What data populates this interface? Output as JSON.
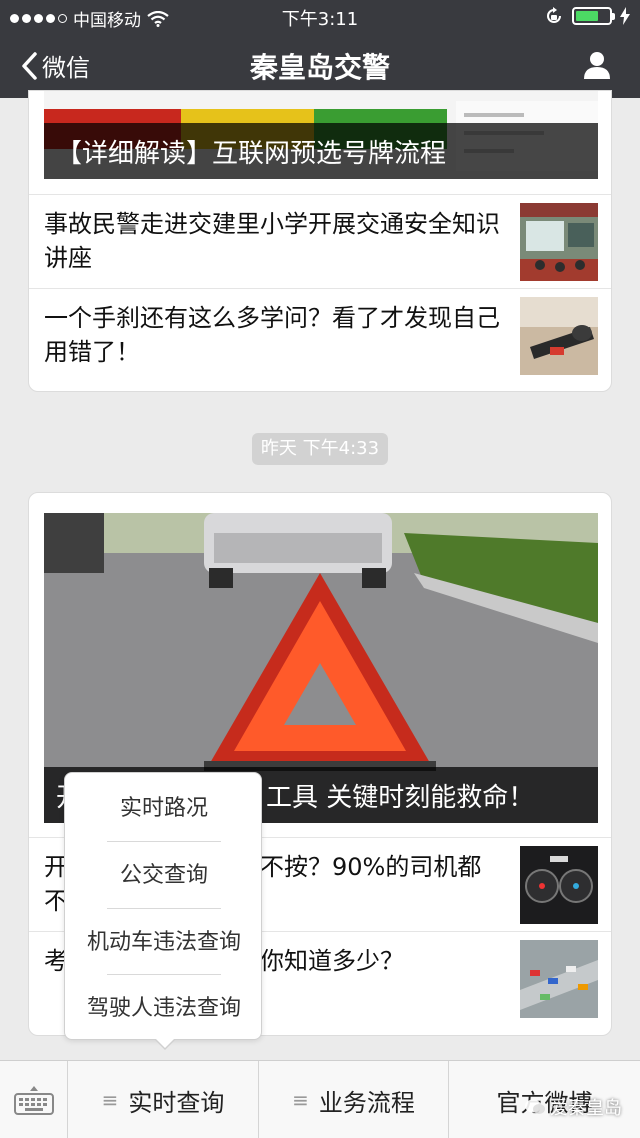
{
  "status_bar": {
    "carrier": "中国移动",
    "time": "下午3:11"
  },
  "nav": {
    "back_label": "微信",
    "title": "秦皇岛交警"
  },
  "card1": {
    "hero_caption": "【详细解读】互联网预选号牌流程",
    "articles": [
      {
        "title": "事故民警走进交建里小学开展交通安全知识讲座"
      },
      {
        "title": "一个手刹还有这么多学问？看了才发现自己用错了！"
      }
    ]
  },
  "timestamp": "昨天 下午4:33",
  "card2": {
    "hero_caption": "开车必备的这个工具 关键时刻能救命！",
    "hero_caption_visible_right": "工具 关键时刻能救命！",
    "hero_caption_visible_left": "开",
    "articles": [
      {
        "visible_left": "开",
        "visible_left2": "不",
        "visible_right": "不按？90%的司机都"
      },
      {
        "visible_left": "考",
        "visible_right": "你知道多少？"
      }
    ]
  },
  "popup_menu": {
    "items": [
      "实时路况",
      "公交查询",
      "机动车违法查询",
      "驾驶人违法查询"
    ]
  },
  "bottom_menu": {
    "tabs": [
      "实时查询",
      "业务流程",
      "官方微博"
    ]
  },
  "watermark": "爱秦皇岛",
  "colors": {
    "nav_bg": "#393a3f",
    "battery_green": "#4cd964"
  }
}
